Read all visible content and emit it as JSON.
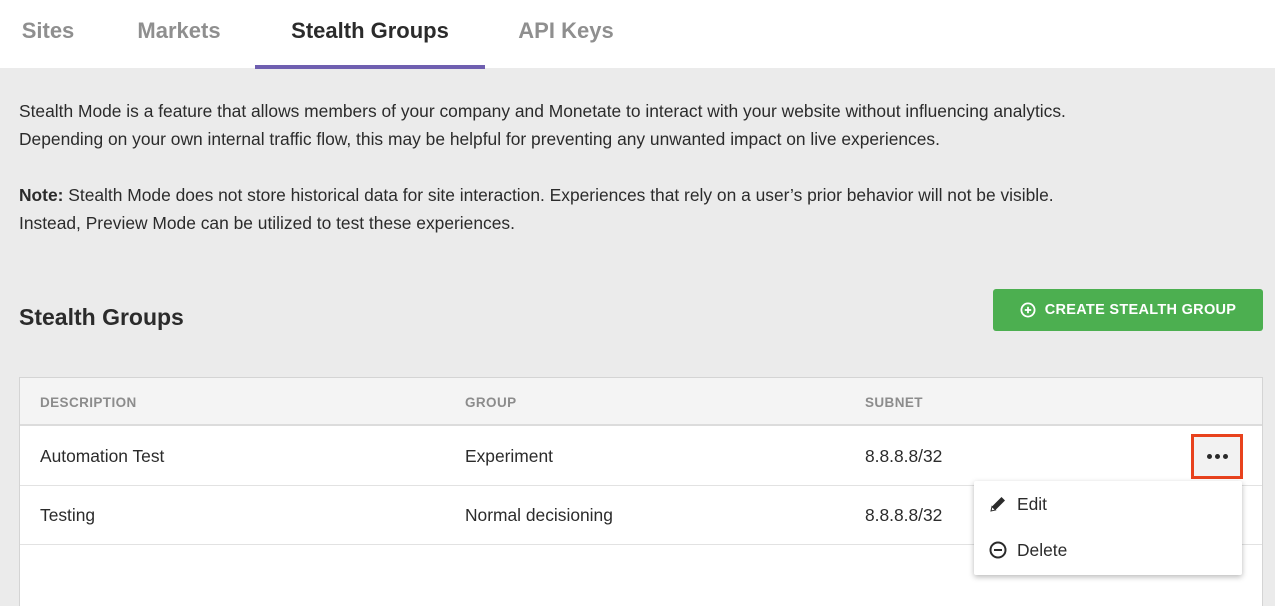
{
  "tabs": [
    {
      "label": "Sites"
    },
    {
      "label": "Markets"
    },
    {
      "label": "Stealth Groups",
      "active": true
    },
    {
      "label": "API Keys"
    }
  ],
  "intro": {
    "line1": "Stealth Mode is a feature that allows members of your company and Monetate to interact with your website without influencing analytics.",
    "line2": "Depending on your own internal traffic flow, this may be helpful for preventing any unwanted impact on live experiences."
  },
  "note": {
    "label": "Note:",
    "line1": " Stealth Mode does not store historical data for site interaction. Experiences that rely on a user’s prior behavior will not be visible.",
    "line2": "Instead, Preview Mode can be utilized to test these experiences."
  },
  "section": {
    "title": "Stealth Groups",
    "create_button": "CREATE STEALTH GROUP",
    "create_icon": "plus-circle-icon"
  },
  "table": {
    "columns": [
      "DESCRIPTION",
      "GROUP",
      "SUBNET"
    ],
    "rows": [
      {
        "description": "Automation Test",
        "group": "Experiment",
        "subnet": "8.8.8.8/32"
      },
      {
        "description": "Testing",
        "group": "Normal decisioning",
        "subnet": "8.8.8.8/32"
      }
    ]
  },
  "row_menu": {
    "trigger_icon": "more-horizontal-icon",
    "items": [
      {
        "label": "Edit",
        "icon": "pencil-icon"
      },
      {
        "label": "Delete",
        "icon": "minus-circle-icon"
      }
    ]
  },
  "colors": {
    "accent_underline": "#6f5fb0",
    "create_button": "#4caf50",
    "highlight_border": "#e8421d"
  }
}
